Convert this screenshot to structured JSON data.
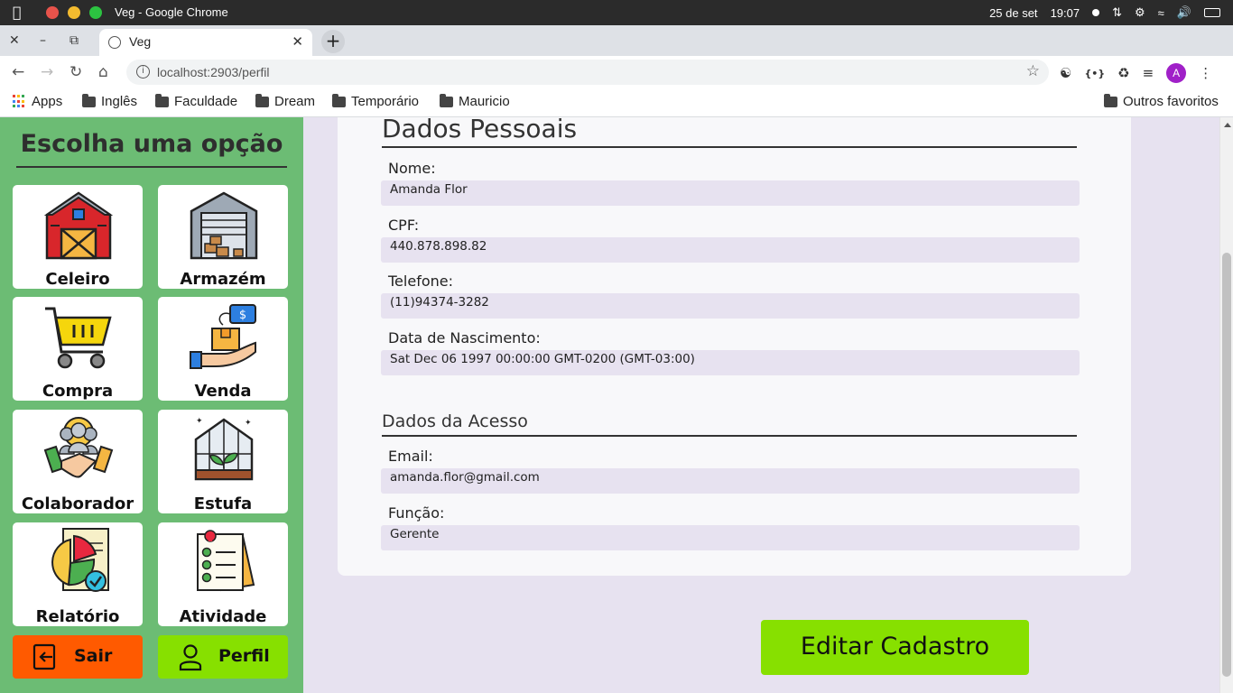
{
  "os_bar": {
    "window_title": "Veg - Google Chrome",
    "date": "25 de set",
    "time": "19:07"
  },
  "browser": {
    "tab_title": "Veg",
    "url": "localhost:2903/perfil",
    "profile_initial": "A",
    "bookmarks": [
      "Apps",
      "Inglês",
      "Faculdade",
      "Dream",
      "Temporário",
      "Mauricio"
    ],
    "other_bookmarks": "Outros favoritos"
  },
  "sidebar": {
    "title": "Escolha uma opção",
    "cards": [
      {
        "label": "Celeiro",
        "icon": "barn-icon"
      },
      {
        "label": "Armazém",
        "icon": "warehouse-icon"
      },
      {
        "label": "Compra",
        "icon": "shopping-cart-icon"
      },
      {
        "label": "Venda",
        "icon": "sale-box-hand-icon"
      },
      {
        "label": "Colaborador",
        "icon": "handshake-team-icon"
      },
      {
        "label": "Estufa",
        "icon": "greenhouse-icon"
      },
      {
        "label": "Relatório",
        "icon": "report-chart-icon"
      },
      {
        "label": "Atividade",
        "icon": "checklist-icon"
      }
    ],
    "logout_label": "Sair",
    "profile_label": "Perfil",
    "colors": {
      "background": "#6cbc74",
      "logout": "#ff5a00",
      "profile": "#87e000"
    }
  },
  "profile": {
    "personal_heading": "Dados Pessoais",
    "access_heading": "Dados da Acesso",
    "fields": {
      "nome": {
        "label": "Nome:",
        "value": "Amanda Flor"
      },
      "cpf": {
        "label": "CPF:",
        "value": "440.878.898.82"
      },
      "telefone": {
        "label": "Telefone:",
        "value": "(11)94374-3282"
      },
      "nascimento": {
        "label": "Data de Nascimento:",
        "value": "Sat Dec 06 1997 00:00:00 GMT-0200 (GMT-03:00)"
      },
      "email": {
        "label": "Email:",
        "value": "amanda.flor@gmail.com"
      },
      "funcao": {
        "label": "Função:",
        "value": "Gerente"
      }
    },
    "edit_button": "Editar Cadastro"
  }
}
